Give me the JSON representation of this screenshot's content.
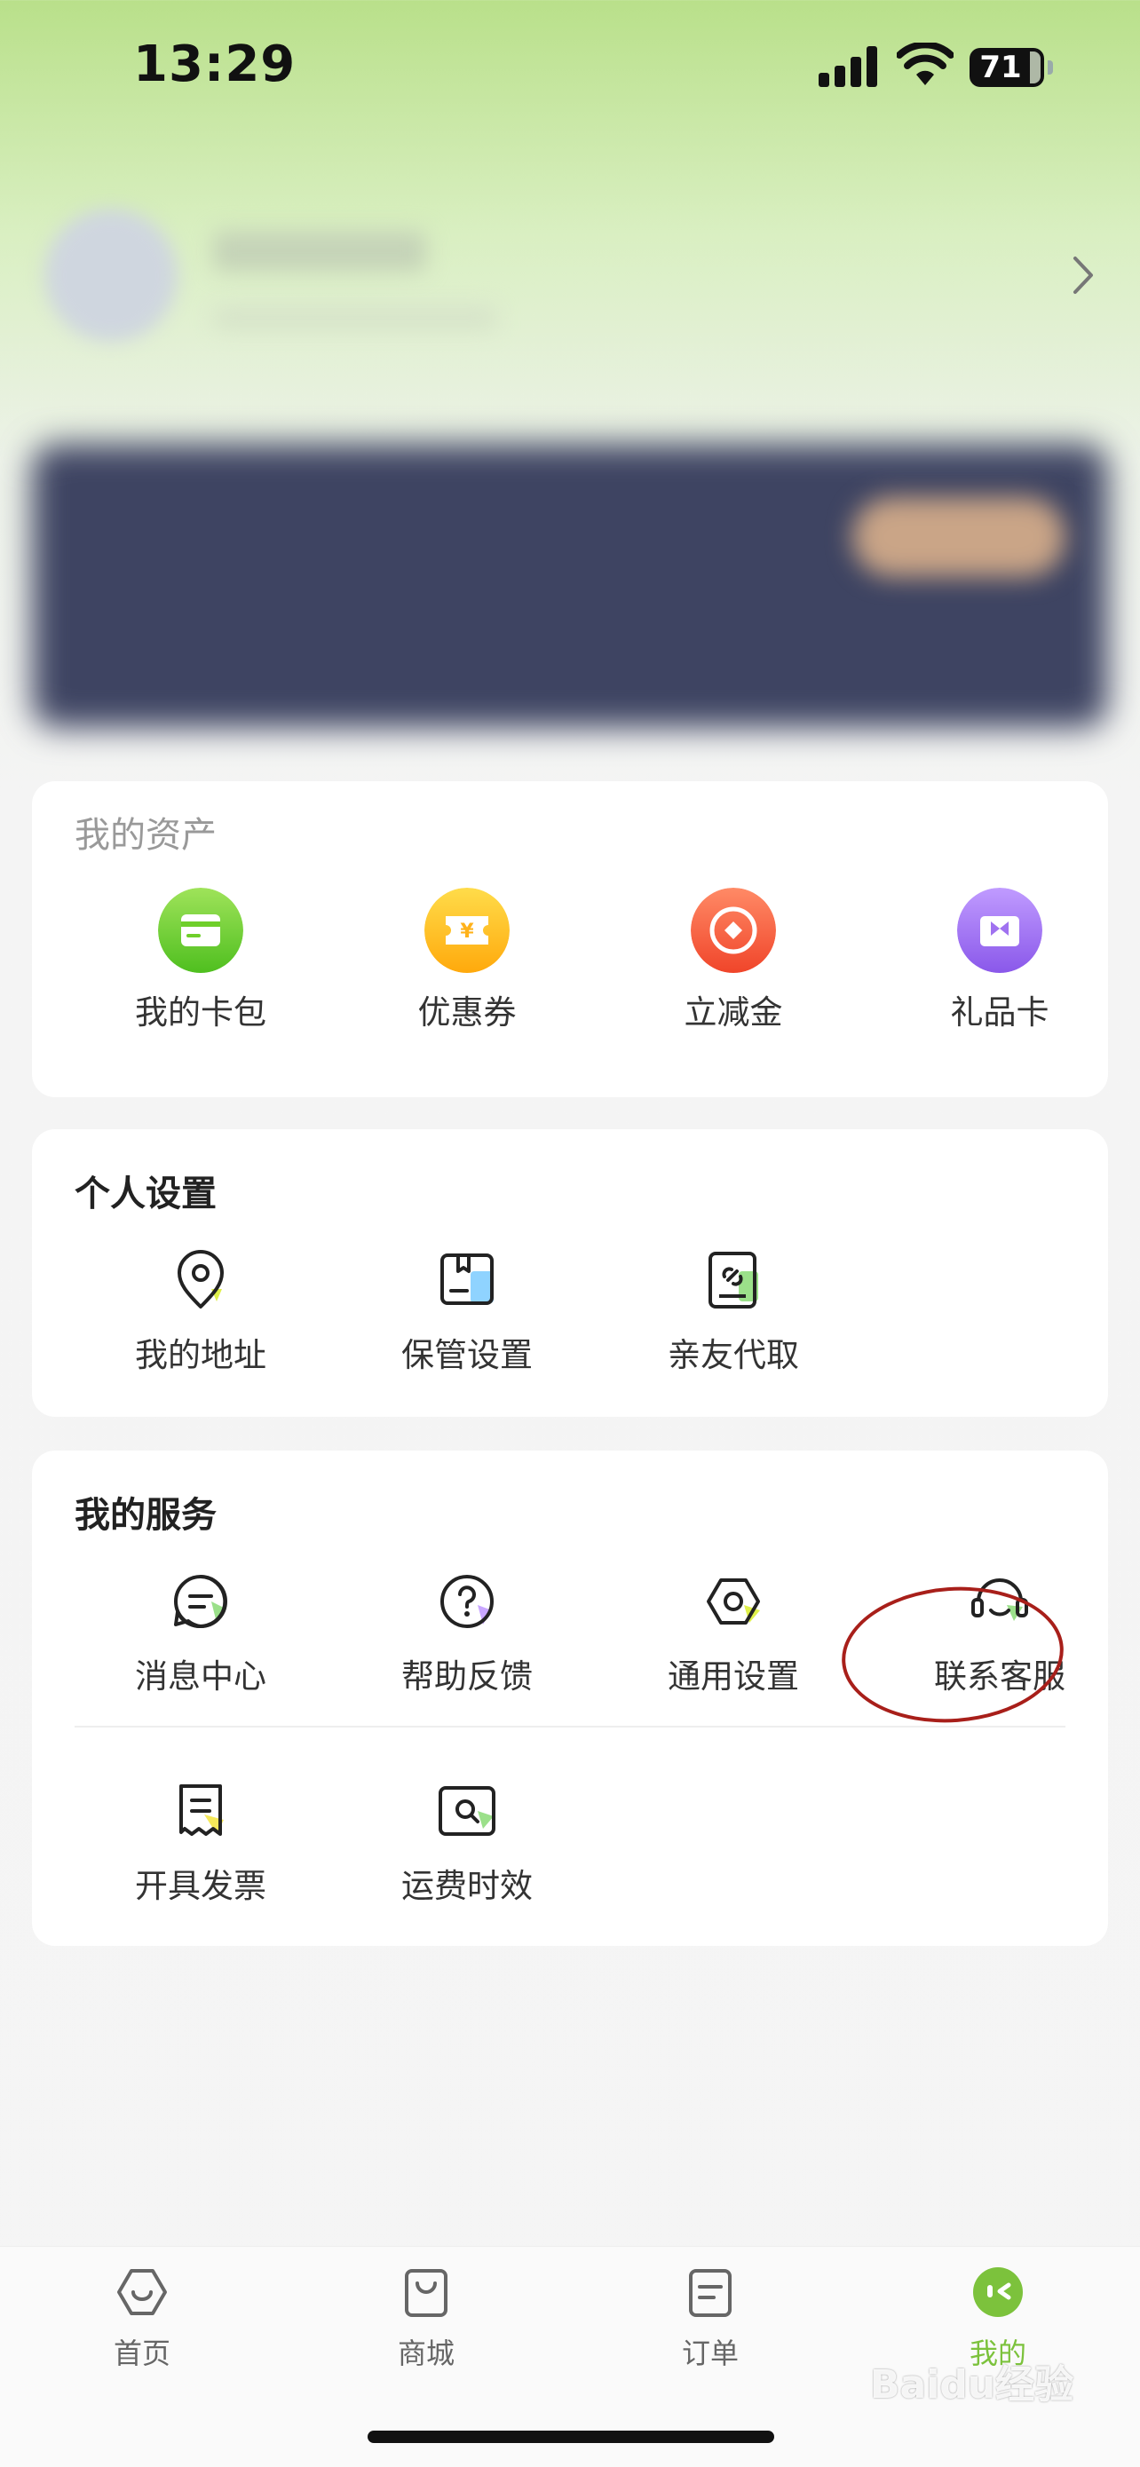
{
  "status_bar": {
    "time": "13:29",
    "battery": "71"
  },
  "assets": {
    "title": "我的资产",
    "items": [
      {
        "label": "我的卡包",
        "icon": "card-wallet-icon",
        "color": "#6fcf2a"
      },
      {
        "label": "优惠券",
        "icon": "coupon-icon",
        "color": "#ffc21f"
      },
      {
        "label": "立减金",
        "icon": "discount-coin-icon",
        "color": "#f5603d"
      },
      {
        "label": "礼品卡",
        "icon": "gift-card-icon",
        "color": "#a072f0"
      }
    ]
  },
  "personal_settings": {
    "title": "个人设置",
    "items": [
      {
        "label": "我的地址",
        "icon": "location-pin-icon"
      },
      {
        "label": "保管设置",
        "icon": "storage-box-icon"
      },
      {
        "label": "亲友代取",
        "icon": "link-phone-icon"
      }
    ]
  },
  "services": {
    "title": "我的服务",
    "items": [
      {
        "label": "消息中心",
        "icon": "message-icon"
      },
      {
        "label": "帮助反馈",
        "icon": "help-question-icon"
      },
      {
        "label": "通用设置",
        "icon": "settings-hex-icon"
      },
      {
        "label": "联系客服",
        "icon": "headset-icon"
      },
      {
        "label": "开具发票",
        "icon": "receipt-icon"
      },
      {
        "label": "运费时效",
        "icon": "search-box-icon"
      }
    ]
  },
  "tabbar": {
    "items": [
      {
        "label": "首页",
        "icon": "home-hexagon-icon"
      },
      {
        "label": "商城",
        "icon": "shopping-bag-icon"
      },
      {
        "label": "订单",
        "icon": "order-list-icon"
      },
      {
        "label": "我的",
        "icon": "profile-face-icon",
        "active": true
      }
    ],
    "active_color": "#7cc23c"
  },
  "watermark": "Baidu经验"
}
